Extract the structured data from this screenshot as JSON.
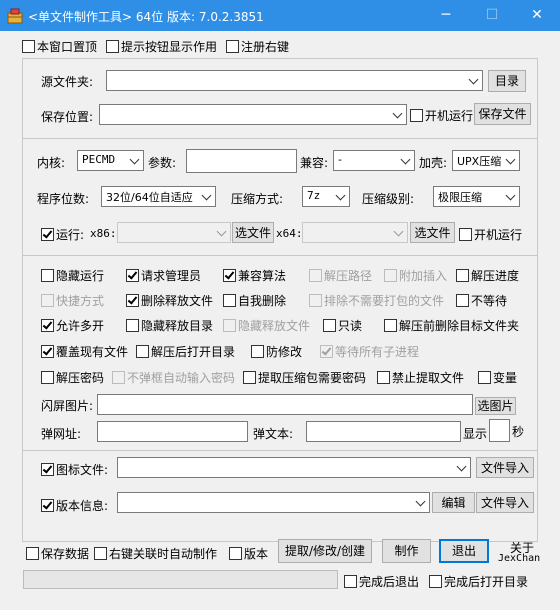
{
  "window": {
    "title": "<单文件制作工具> 64位 版本: 7.0.2.3851",
    "minimize": "─",
    "maximize": "☐",
    "close": "✕"
  },
  "topbar": {
    "on_top": {
      "label": "本窗口置顶",
      "checked": false
    },
    "tips": {
      "label": "提示按钮显示作用",
      "checked": false
    },
    "register": {
      "label": "注册右键",
      "checked": false
    }
  },
  "source": {
    "source_label": "源文件夹:",
    "dir_button": "目录",
    "save_label": "保存位置:",
    "autorun": {
      "label": "开机运行",
      "checked": false
    },
    "save_button": "保存文件"
  },
  "kernel": {
    "kernel_label": "内核:",
    "kernel_value": "PECMD",
    "param_label": "参数:",
    "compat_label": "兼容:",
    "compat_value": "-",
    "shell_label": "加壳:",
    "shell_value": "UPX压缩",
    "bits_label": "程序位数:",
    "bits_value": "32位/64位自适应",
    "method_label": "压缩方式:",
    "method_value": "7z",
    "level_label": "压缩级别:",
    "level_value": "极限压缩",
    "run": {
      "label": "运行:",
      "checked": true
    },
    "x86_label": "x86:",
    "x86_button": "选文件",
    "x64_label": "x64:",
    "x64_button": "选文件",
    "autorun2": {
      "label": "开机运行",
      "checked": false
    }
  },
  "options": [
    {
      "label": "隐藏运行",
      "checked": false,
      "disabled": false
    },
    {
      "label": "请求管理员",
      "checked": true,
      "disabled": false
    },
    {
      "label": "兼容算法",
      "checked": true,
      "disabled": false
    },
    {
      "label": "解压路径",
      "checked": false,
      "disabled": true
    },
    {
      "label": "附加插入",
      "checked": false,
      "disabled": true
    },
    {
      "label": "解压进度",
      "checked": false,
      "disabled": false
    },
    {
      "label": "快捷方式",
      "checked": false,
      "disabled": true
    },
    {
      "label": "删除释放文件",
      "checked": true,
      "disabled": false
    },
    {
      "label": "自我删除",
      "checked": false,
      "disabled": false
    },
    {
      "label": "排除不需要打包的文件",
      "checked": false,
      "disabled": true
    },
    {
      "label": "不等待",
      "checked": false,
      "disabled": false
    },
    {
      "label": "允许多开",
      "checked": true,
      "disabled": false
    },
    {
      "label": "隐藏释放目录",
      "checked": false,
      "disabled": false
    },
    {
      "label": "隐藏释放文件",
      "checked": false,
      "disabled": true
    },
    {
      "label": "只读",
      "checked": false,
      "disabled": false
    },
    {
      "label": "解压前删除目标文件夹",
      "checked": false,
      "disabled": false
    },
    {
      "label": "覆盖现有文件",
      "checked": true,
      "disabled": false
    },
    {
      "label": "解压后打开目录",
      "checked": false,
      "disabled": false
    },
    {
      "label": "防修改",
      "checked": false,
      "disabled": false
    },
    {
      "label": "等待所有子进程",
      "checked": true,
      "disabled": true
    },
    {
      "label": "解压密码",
      "checked": false,
      "disabled": false
    },
    {
      "label": "不弹框自动输入密码",
      "checked": false,
      "disabled": true
    },
    {
      "label": "提取压缩包需要密码",
      "checked": false,
      "disabled": false
    },
    {
      "label": "禁止提取文件",
      "checked": false,
      "disabled": false
    },
    {
      "label": "变量",
      "checked": false,
      "disabled": false
    }
  ],
  "splash": {
    "label": "闪屏图片:",
    "button": "选图片"
  },
  "popup": {
    "url_label": "弹网址:",
    "text_label": "弹文本:",
    "show_label": "显示",
    "sec_label": "秒"
  },
  "icon": {
    "label": "图标文件:",
    "checked": true,
    "import_button": "文件导入"
  },
  "version": {
    "label": "版本信息:",
    "checked": true,
    "edit_button": "编辑",
    "import_button": "文件导入"
  },
  "bottom": {
    "save_data": {
      "label": "保存数据",
      "checked": false
    },
    "right_click": {
      "label": "右键关联时自动制作",
      "checked": false
    },
    "version": {
      "label": "版本",
      "checked": false
    },
    "extract_button": "提取/修改/创建",
    "make_button": "制作",
    "exit_button": "退出",
    "about_line1": "关于",
    "about_line2": "JexChan",
    "exit_after": {
      "label": "完成后退出",
      "checked": false
    },
    "open_after": {
      "label": "完成后打开目录",
      "checked": false
    }
  }
}
